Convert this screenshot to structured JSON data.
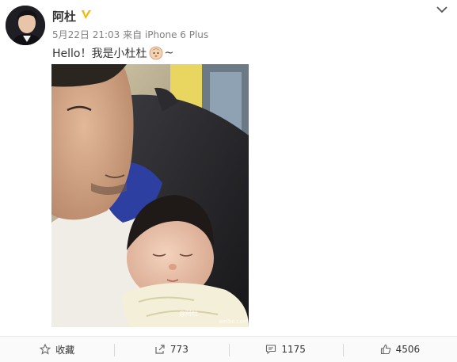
{
  "post": {
    "username": "阿杜",
    "timestamp": "5月22日 21:03",
    "source": "来自 iPhone 6 Plus",
    "text_before": "Hello！我是小杜杜",
    "text_after": "~",
    "emoji": "baby-face-emoji",
    "photo_watermark": "@阿杜",
    "photo_watermark_url": "weibo.com/aduofficial"
  },
  "actions": {
    "favorite_label": "收藏",
    "repost_count": "773",
    "comment_count": "1175",
    "like_count": "4506"
  },
  "colors": {
    "verified_badge": "#f5b800",
    "meta_text": "#808080",
    "divider": "#e8e8e8"
  }
}
